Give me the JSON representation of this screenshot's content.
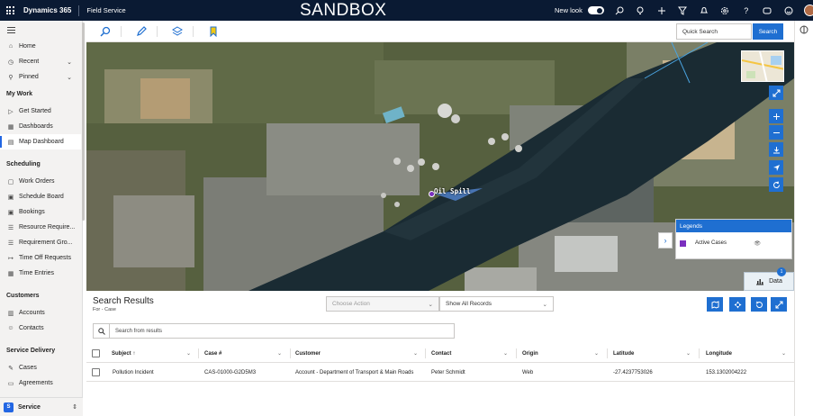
{
  "header": {
    "app_name": "Dynamics 365",
    "module": "Field Service",
    "environment_banner": "SANDBOX",
    "new_look_label": "New look",
    "new_look_enabled": true,
    "icons": [
      "search-icon",
      "lightbulb-icon",
      "plus-icon",
      "filter-icon",
      "settings-icon",
      "help-icon",
      "copilot-icon",
      "smiley-icon"
    ]
  },
  "sidebar": {
    "top_items": [
      {
        "label": "Home",
        "icon": "home-icon"
      },
      {
        "label": "Recent",
        "icon": "clock-icon",
        "expandable": true
      },
      {
        "label": "Pinned",
        "icon": "pin-icon",
        "expandable": true
      }
    ],
    "groups": [
      {
        "title": "My Work",
        "items": [
          {
            "label": "Get Started",
            "icon": "play-icon"
          },
          {
            "label": "Dashboards",
            "icon": "dashboard-icon"
          },
          {
            "label": "Map Dashboard",
            "icon": "map-icon",
            "active": true
          }
        ]
      },
      {
        "title": "Scheduling",
        "items": [
          {
            "label": "Work Orders",
            "icon": "clipboard-icon"
          },
          {
            "label": "Schedule Board",
            "icon": "calendar-icon"
          },
          {
            "label": "Bookings",
            "icon": "calendar-check-icon"
          },
          {
            "label": "Resource Require...",
            "icon": "list-icon"
          },
          {
            "label": "Requirement Gro...",
            "icon": "list-icon"
          },
          {
            "label": "Time Off Requests",
            "icon": "arrow-icon"
          },
          {
            "label": "Time Entries",
            "icon": "grid-icon"
          }
        ]
      },
      {
        "title": "Customers",
        "items": [
          {
            "label": "Accounts",
            "icon": "building-icon"
          },
          {
            "label": "Contacts",
            "icon": "person-icon"
          }
        ]
      },
      {
        "title": "Service Delivery",
        "items": [
          {
            "label": "Cases",
            "icon": "wrench-icon"
          },
          {
            "label": "Agreements",
            "icon": "document-icon"
          }
        ]
      }
    ],
    "area": {
      "badge": "S",
      "label": "Service"
    }
  },
  "map_toolbar": {
    "tools": [
      "search-icon",
      "pencil-icon",
      "layers-icon",
      "bookmark-icon"
    ],
    "quick_search_placeholder": "Quick Search",
    "search_button": "Search"
  },
  "map": {
    "annotation_label": "Oil Spill",
    "legend_title": "Legends",
    "legend_items": [
      {
        "label": "Active Cases",
        "color": "#7b2fbf"
      }
    ],
    "data_button": "Data",
    "data_badge": "1",
    "controls": [
      "expand-icon",
      "zoom-in-icon",
      "zoom-out-icon",
      "download-icon",
      "locate-icon",
      "refresh-icon"
    ]
  },
  "results": {
    "title": "Search Results",
    "subtitle": "For - Case",
    "choose_action": "Choose Action",
    "view_select": "Show All Records",
    "search_placeholder": "Search from results",
    "columns": [
      "Subject",
      "Case #",
      "Customer",
      "Contact",
      "Origin",
      "Latitude",
      "Longitude"
    ],
    "sort_indicator": "↑",
    "rows": [
      [
        "Pollution Incident",
        "CAS-01000-G2D5M3",
        "Account - Department of Transport & Main Roads",
        "Peter Schmidt",
        "Web",
        "-27.4237753026",
        "153.1302004222"
      ]
    ]
  },
  "colors": {
    "topbar": "#0a1a33",
    "accent": "#1f6fd1",
    "legend_swatch": "#7b2fbf"
  }
}
